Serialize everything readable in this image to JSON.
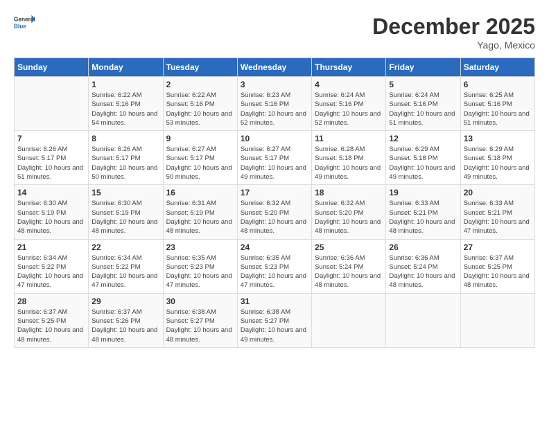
{
  "header": {
    "logo_line1": "General",
    "logo_line2": "Blue",
    "month": "December 2025",
    "location": "Yago, Mexico"
  },
  "weekdays": [
    "Sunday",
    "Monday",
    "Tuesday",
    "Wednesday",
    "Thursday",
    "Friday",
    "Saturday"
  ],
  "weeks": [
    [
      {
        "day": "",
        "sunrise": "",
        "sunset": "",
        "daylight": ""
      },
      {
        "day": "1",
        "sunrise": "Sunrise: 6:22 AM",
        "sunset": "Sunset: 5:16 PM",
        "daylight": "Daylight: 10 hours and 54 minutes."
      },
      {
        "day": "2",
        "sunrise": "Sunrise: 6:22 AM",
        "sunset": "Sunset: 5:16 PM",
        "daylight": "Daylight: 10 hours and 53 minutes."
      },
      {
        "day": "3",
        "sunrise": "Sunrise: 6:23 AM",
        "sunset": "Sunset: 5:16 PM",
        "daylight": "Daylight: 10 hours and 52 minutes."
      },
      {
        "day": "4",
        "sunrise": "Sunrise: 6:24 AM",
        "sunset": "Sunset: 5:16 PM",
        "daylight": "Daylight: 10 hours and 52 minutes."
      },
      {
        "day": "5",
        "sunrise": "Sunrise: 6:24 AM",
        "sunset": "Sunset: 5:16 PM",
        "daylight": "Daylight: 10 hours and 51 minutes."
      },
      {
        "day": "6",
        "sunrise": "Sunrise: 6:25 AM",
        "sunset": "Sunset: 5:16 PM",
        "daylight": "Daylight: 10 hours and 51 minutes."
      }
    ],
    [
      {
        "day": "7",
        "sunrise": "Sunrise: 6:26 AM",
        "sunset": "Sunset: 5:17 PM",
        "daylight": "Daylight: 10 hours and 51 minutes."
      },
      {
        "day": "8",
        "sunrise": "Sunrise: 6:26 AM",
        "sunset": "Sunset: 5:17 PM",
        "daylight": "Daylight: 10 hours and 50 minutes."
      },
      {
        "day": "9",
        "sunrise": "Sunrise: 6:27 AM",
        "sunset": "Sunset: 5:17 PM",
        "daylight": "Daylight: 10 hours and 50 minutes."
      },
      {
        "day": "10",
        "sunrise": "Sunrise: 6:27 AM",
        "sunset": "Sunset: 5:17 PM",
        "daylight": "Daylight: 10 hours and 49 minutes."
      },
      {
        "day": "11",
        "sunrise": "Sunrise: 6:28 AM",
        "sunset": "Sunset: 5:18 PM",
        "daylight": "Daylight: 10 hours and 49 minutes."
      },
      {
        "day": "12",
        "sunrise": "Sunrise: 6:29 AM",
        "sunset": "Sunset: 5:18 PM",
        "daylight": "Daylight: 10 hours and 49 minutes."
      },
      {
        "day": "13",
        "sunrise": "Sunrise: 6:29 AM",
        "sunset": "Sunset: 5:18 PM",
        "daylight": "Daylight: 10 hours and 49 minutes."
      }
    ],
    [
      {
        "day": "14",
        "sunrise": "Sunrise: 6:30 AM",
        "sunset": "Sunset: 5:19 PM",
        "daylight": "Daylight: 10 hours and 48 minutes."
      },
      {
        "day": "15",
        "sunrise": "Sunrise: 6:30 AM",
        "sunset": "Sunset: 5:19 PM",
        "daylight": "Daylight: 10 hours and 48 minutes."
      },
      {
        "day": "16",
        "sunrise": "Sunrise: 6:31 AM",
        "sunset": "Sunset: 5:19 PM",
        "daylight": "Daylight: 10 hours and 48 minutes."
      },
      {
        "day": "17",
        "sunrise": "Sunrise: 6:32 AM",
        "sunset": "Sunset: 5:20 PM",
        "daylight": "Daylight: 10 hours and 48 minutes."
      },
      {
        "day": "18",
        "sunrise": "Sunrise: 6:32 AM",
        "sunset": "Sunset: 5:20 PM",
        "daylight": "Daylight: 10 hours and 48 minutes."
      },
      {
        "day": "19",
        "sunrise": "Sunrise: 6:33 AM",
        "sunset": "Sunset: 5:21 PM",
        "daylight": "Daylight: 10 hours and 48 minutes."
      },
      {
        "day": "20",
        "sunrise": "Sunrise: 6:33 AM",
        "sunset": "Sunset: 5:21 PM",
        "daylight": "Daylight: 10 hours and 47 minutes."
      }
    ],
    [
      {
        "day": "21",
        "sunrise": "Sunrise: 6:34 AM",
        "sunset": "Sunset: 5:22 PM",
        "daylight": "Daylight: 10 hours and 47 minutes."
      },
      {
        "day": "22",
        "sunrise": "Sunrise: 6:34 AM",
        "sunset": "Sunset: 5:22 PM",
        "daylight": "Daylight: 10 hours and 47 minutes."
      },
      {
        "day": "23",
        "sunrise": "Sunrise: 6:35 AM",
        "sunset": "Sunset: 5:23 PM",
        "daylight": "Daylight: 10 hours and 47 minutes."
      },
      {
        "day": "24",
        "sunrise": "Sunrise: 6:35 AM",
        "sunset": "Sunset: 5:23 PM",
        "daylight": "Daylight: 10 hours and 47 minutes."
      },
      {
        "day": "25",
        "sunrise": "Sunrise: 6:36 AM",
        "sunset": "Sunset: 5:24 PM",
        "daylight": "Daylight: 10 hours and 48 minutes."
      },
      {
        "day": "26",
        "sunrise": "Sunrise: 6:36 AM",
        "sunset": "Sunset: 5:24 PM",
        "daylight": "Daylight: 10 hours and 48 minutes."
      },
      {
        "day": "27",
        "sunrise": "Sunrise: 6:37 AM",
        "sunset": "Sunset: 5:25 PM",
        "daylight": "Daylight: 10 hours and 48 minutes."
      }
    ],
    [
      {
        "day": "28",
        "sunrise": "Sunrise: 6:37 AM",
        "sunset": "Sunset: 5:25 PM",
        "daylight": "Daylight: 10 hours and 48 minutes."
      },
      {
        "day": "29",
        "sunrise": "Sunrise: 6:37 AM",
        "sunset": "Sunset: 5:26 PM",
        "daylight": "Daylight: 10 hours and 48 minutes."
      },
      {
        "day": "30",
        "sunrise": "Sunrise: 6:38 AM",
        "sunset": "Sunset: 5:27 PM",
        "daylight": "Daylight: 10 hours and 48 minutes."
      },
      {
        "day": "31",
        "sunrise": "Sunrise: 6:38 AM",
        "sunset": "Sunset: 5:27 PM",
        "daylight": "Daylight: 10 hours and 49 minutes."
      },
      {
        "day": "",
        "sunrise": "",
        "sunset": "",
        "daylight": ""
      },
      {
        "day": "",
        "sunrise": "",
        "sunset": "",
        "daylight": ""
      },
      {
        "day": "",
        "sunrise": "",
        "sunset": "",
        "daylight": ""
      }
    ]
  ]
}
